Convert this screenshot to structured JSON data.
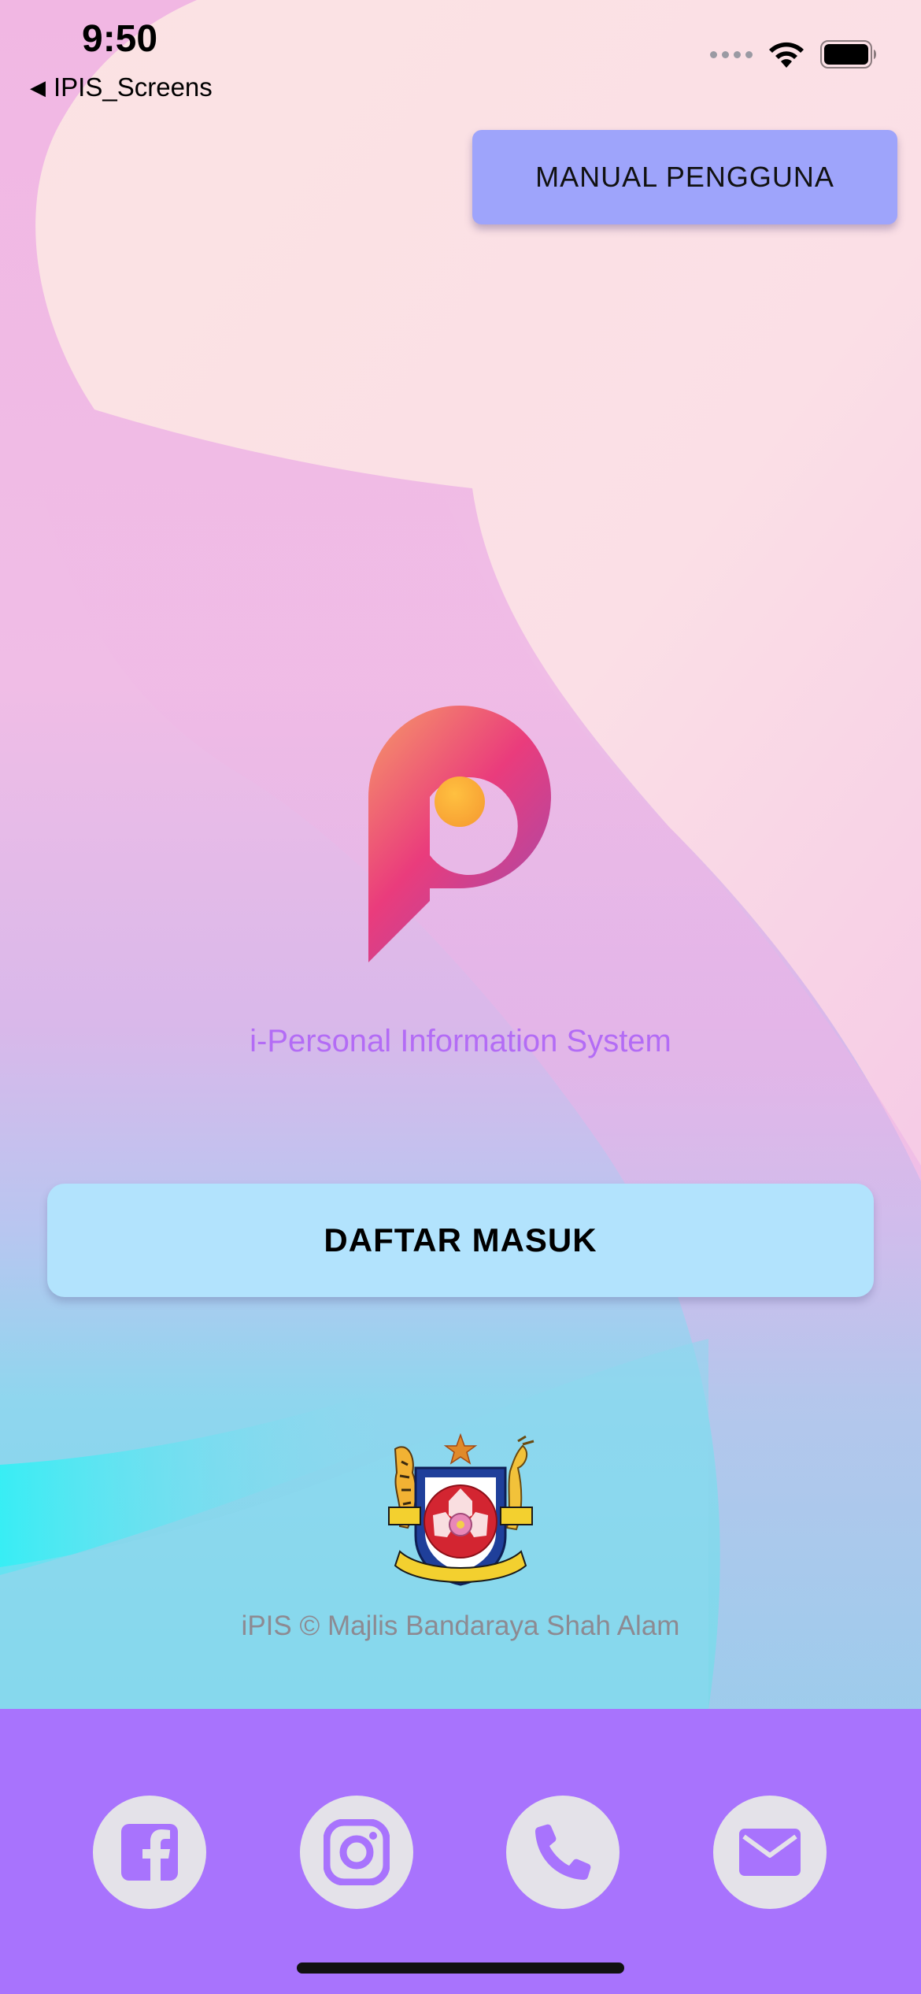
{
  "status_bar": {
    "time": "9:50",
    "back_label": "IPIS_Screens",
    "icons": [
      "cellular-dots-icon",
      "wifi-icon",
      "battery-icon"
    ]
  },
  "header": {
    "manual_button_label": "MANUAL PENGGUNA"
  },
  "branding": {
    "tagline": "i-Personal Information System",
    "tagline_color": "#b36cf5"
  },
  "login": {
    "button_label": "DAFTAR MASUK"
  },
  "footer": {
    "emblem_text": "MAJLIS BANDARAYA SHAH ALAM",
    "copyright": "iPIS © Majlis Bandaraya Shah Alam"
  },
  "social_bar": {
    "background": "#a873fd",
    "icon_color": "#a873fd",
    "items": [
      {
        "icon": "facebook-icon"
      },
      {
        "icon": "instagram-icon"
      },
      {
        "icon": "phone-icon"
      },
      {
        "icon": "mail-icon"
      }
    ]
  }
}
